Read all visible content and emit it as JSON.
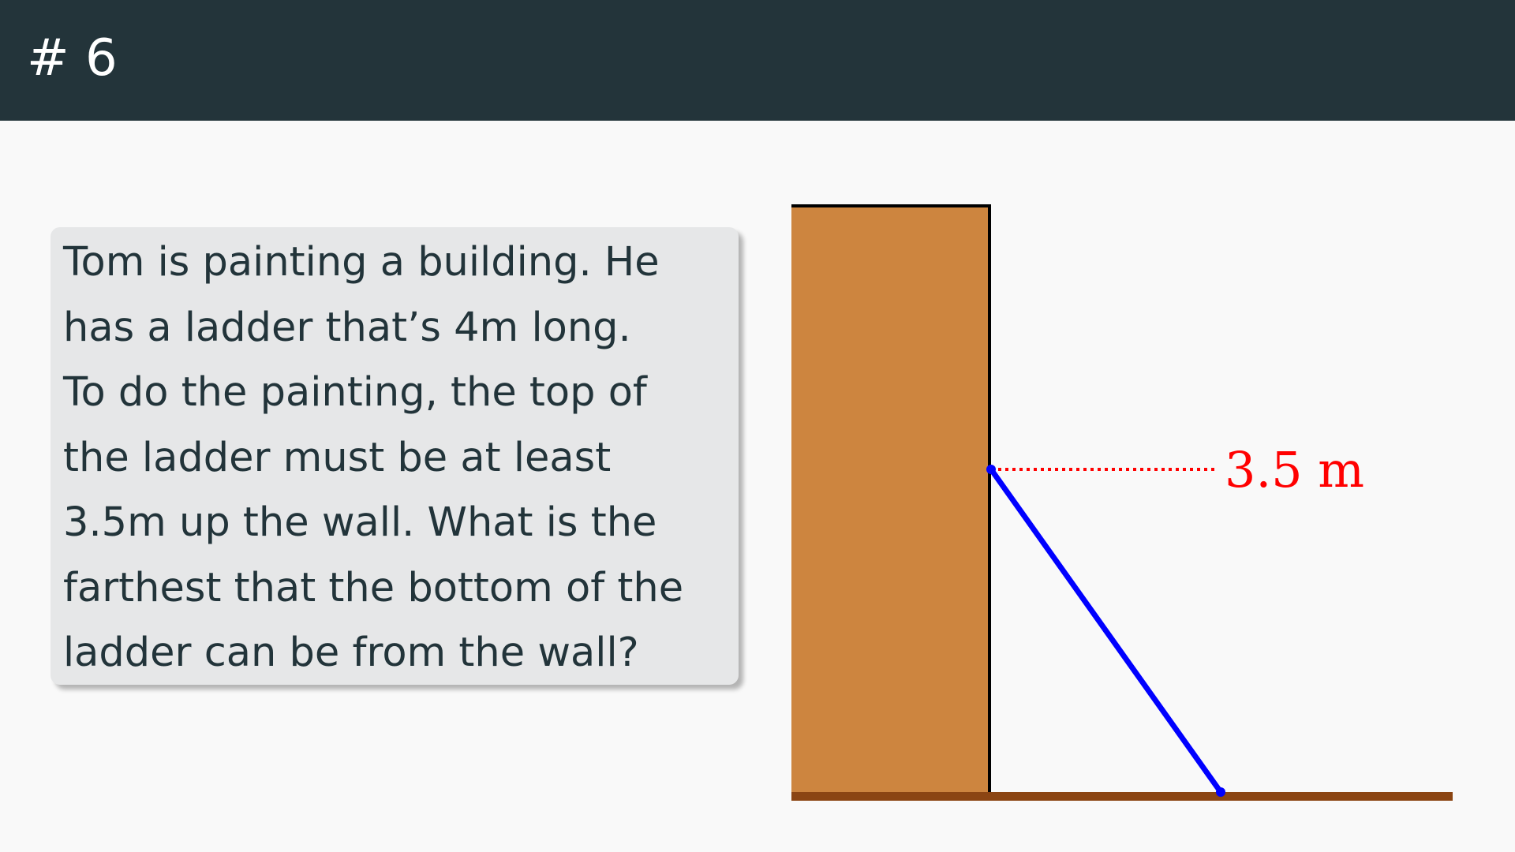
{
  "header": {
    "title": "# 6"
  },
  "problem": {
    "lines": [
      "Tom is painting a building.  He",
      "has a ladder that’s 4m long.",
      "To do the painting, the top of",
      "the ladder must be at least",
      "3.5m up the wall.  What is the",
      "farthest that the bottom of the",
      "ladder can be from the wall?"
    ]
  },
  "diagram": {
    "height_label": "3.5 m",
    "colors": {
      "wall_fill": "#cd853f",
      "wall_outline": "#000000",
      "ground": "#8b4513",
      "ladder": "#0000ff",
      "dimension": "#ff0000"
    }
  }
}
